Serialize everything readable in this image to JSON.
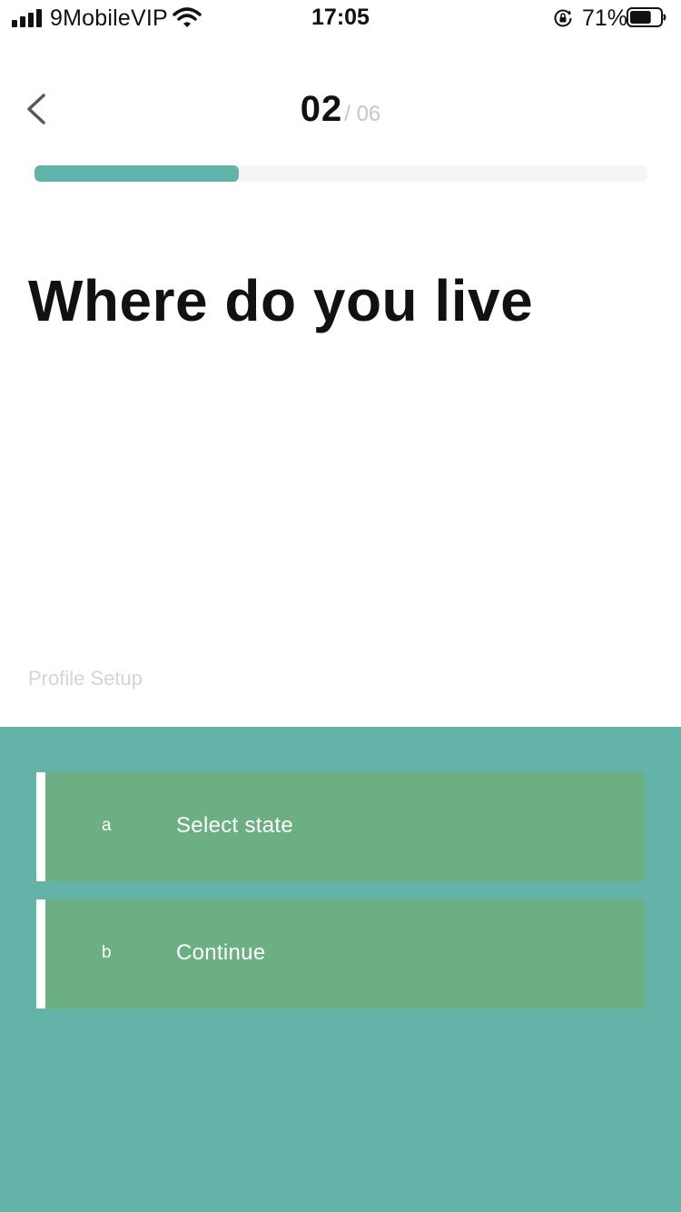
{
  "status_bar": {
    "carrier": "9MobileVIP",
    "time": "17:05",
    "battery_percent": "71%",
    "battery_level": 0.71,
    "signal_bars": 4,
    "icons": [
      "signal-icon",
      "wifi-icon",
      "rotation-lock-icon",
      "battery-icon"
    ]
  },
  "header": {
    "back_icon": "chevron-left-icon",
    "step_current": "02",
    "step_total": "/ 06",
    "progress_fraction": 0.3333
  },
  "question": {
    "title": "Where do you live"
  },
  "section_label": "Profile Setup",
  "options": [
    {
      "key": "a",
      "label": "Select state"
    },
    {
      "key": "b",
      "label": "Continue"
    }
  ],
  "colors": {
    "accent": "#61b2a8",
    "panel_background": "#63b3a9",
    "option_background": "#6caf83",
    "progress_track": "#f3f5f7",
    "muted_text": "#d2d4d6"
  }
}
